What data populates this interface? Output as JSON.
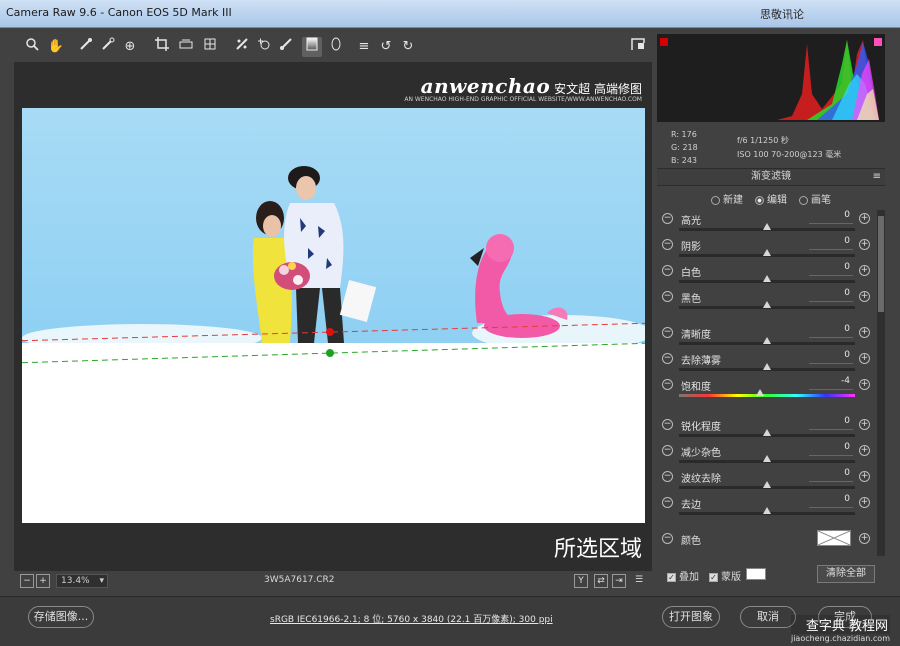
{
  "app": {
    "title": "Camera Raw 9.6 - Canon EOS 5D Mark III",
    "right_title": "思敬讯论"
  },
  "toolbar": {
    "tools": [
      {
        "name": "zoom-tool",
        "glyph": "🔍"
      },
      {
        "name": "hand-tool",
        "glyph": "✋"
      },
      {
        "name": "white-balance-tool",
        "glyph": "✎"
      },
      {
        "name": "color-sampler-tool",
        "glyph": "✎"
      },
      {
        "name": "targeted-adjustment-tool",
        "glyph": "⊕"
      },
      {
        "name": "crop-tool",
        "glyph": "⌐"
      },
      {
        "name": "straighten-tool",
        "glyph": "▭"
      },
      {
        "name": "transform-tool",
        "glyph": "⊞"
      },
      {
        "name": "spot-removal-tool",
        "glyph": "✂"
      },
      {
        "name": "red-eye-tool",
        "glyph": "◉"
      },
      {
        "name": "adjustment-brush-tool",
        "glyph": "✐"
      },
      {
        "name": "graduated-filter-tool",
        "glyph": "▌"
      },
      {
        "name": "radial-filter-tool",
        "glyph": "◯"
      },
      {
        "name": "preferences-tool",
        "glyph": "≡"
      },
      {
        "name": "rotate-left-tool",
        "glyph": "↺"
      },
      {
        "name": "rotate-right-tool",
        "glyph": "↻"
      }
    ],
    "fullscreen_glyph": "⊡"
  },
  "preview": {
    "logo_brand": "anwenchao",
    "logo_cn": "安文超 高端修图",
    "logo_sub": "AN WENCHAO HIGH-END GRAPHIC OFFICIAL WEBSITE/WWW.ANWENCHAO.COM",
    "selected_label": "所选区域"
  },
  "status": {
    "zoom": "13.4%",
    "filename": "3W5A7617.CR2"
  },
  "bottom": {
    "save_label": "存储图像...",
    "info_link": "sRGB IEC61966-2.1; 8 位; 5760 x 3840 (22.1 百万像素); 300 ppi",
    "open_label": "打开图象",
    "cancel_label": "取消",
    "done_label": "完成"
  },
  "watermark": {
    "big": "查字典 教程网",
    "small": "jiaocheng.chazidian.com"
  },
  "readout": {
    "r": "R: 176",
    "g": "G: 218",
    "b": "B: 243",
    "shutter": "f/6 1/1250 秒",
    "iso": "ISO 100 70-200@123 毫米"
  },
  "panel": {
    "title": "渐变滤镜",
    "modes": [
      "新建",
      "编辑",
      "画笔"
    ],
    "selected_mode": "编辑",
    "sliders": [
      {
        "name": "高光",
        "value": "0"
      },
      {
        "name": "阴影",
        "value": "0"
      },
      {
        "name": "白色",
        "value": "0"
      },
      {
        "name": "黑色",
        "value": "0"
      },
      {
        "name": "清晰度",
        "value": "0"
      },
      {
        "name": "去除薄雾",
        "value": "0"
      },
      {
        "name": "饱和度",
        "value": "-4"
      },
      {
        "name": "锐化程度",
        "value": "0"
      },
      {
        "name": "减少杂色",
        "value": "0"
      },
      {
        "name": "波纹去除",
        "value": "0"
      },
      {
        "name": "去边",
        "value": "0"
      }
    ],
    "color_label": "颜色",
    "overlay_label": "叠加",
    "mask_label": "蒙版",
    "clear_all_label": "清除全部"
  },
  "colors": {
    "accent_red": "#d40000",
    "accent_pink": "#ff4fb8",
    "guide_green": "#2aa52a",
    "guide_red": "#e43b3b"
  }
}
